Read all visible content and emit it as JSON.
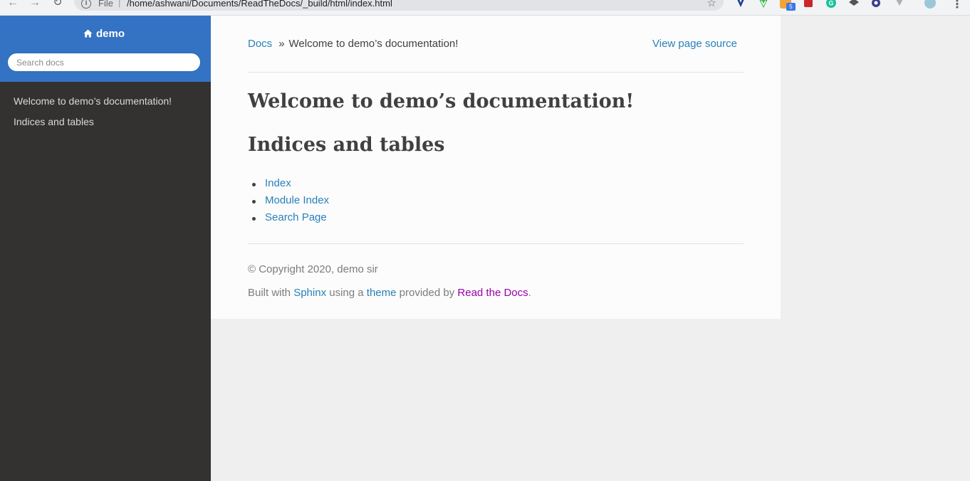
{
  "browser": {
    "scheme_label": "File",
    "separator": "|",
    "url": "/home/ashwani/Documents/ReadTheDocs/_build/html/index.html",
    "extension_badge": "5"
  },
  "sidebar": {
    "project_name": "demo",
    "search_placeholder": "Search docs",
    "items": [
      {
        "label": "Welcome to demo’s documentation!"
      },
      {
        "label": "Indices and tables"
      }
    ]
  },
  "breadcrumb": {
    "root": "Docs",
    "separator": "»",
    "current": "Welcome to demo’s documentation!",
    "view_source": "View page source"
  },
  "main": {
    "title": "Welcome to demo’s documentation!",
    "section_heading": "Indices and tables",
    "links": [
      {
        "label": "Index"
      },
      {
        "label": "Module Index"
      },
      {
        "label": "Search Page"
      }
    ]
  },
  "footer": {
    "copyright": "© Copyright 2020, demo sir",
    "built_prefix": "Built with",
    "sphinx": "Sphinx",
    "using_a": "using a",
    "theme": "theme",
    "provided_by": "provided by",
    "rtd": "Read the Docs",
    "period": "."
  },
  "colors": {
    "sidebar_header": "#3472c4",
    "sidebar_bg": "#343131",
    "link": "#2980b9",
    "rtd_link": "#9b00a8"
  }
}
